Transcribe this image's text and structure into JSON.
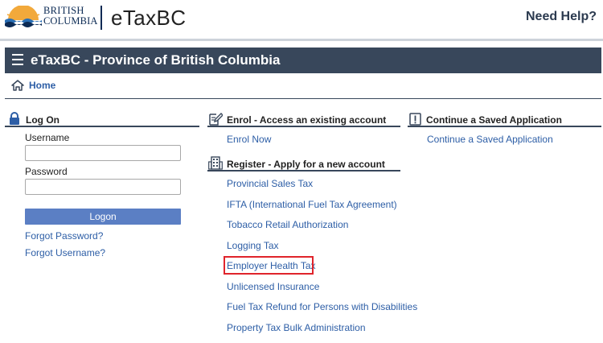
{
  "header": {
    "logo_line1": "BRITISH",
    "logo_line2": "COLUMBIA",
    "app_name": "eTaxBC",
    "help_link": "Need Help?"
  },
  "title_bar": {
    "title": "eTaxBC - Province of British Columbia",
    "menu_icon": "hamburger-menu-icon"
  },
  "breadcrumb": {
    "home_label": "Home",
    "home_icon": "home-icon"
  },
  "logon": {
    "heading": "Log On",
    "heading_icon": "lock-icon",
    "username_label": "Username",
    "username_value": "",
    "password_label": "Password",
    "password_value": "",
    "logon_button": "Logon",
    "forgot_password": "Forgot Password?",
    "forgot_username": "Forgot Username?"
  },
  "enrol": {
    "heading": "Enrol - Access an existing account",
    "heading_icon": "edit-document-icon",
    "links": [
      "Enrol Now"
    ]
  },
  "register": {
    "heading": "Register - Apply for a new account",
    "heading_icon": "building-icon",
    "links": [
      "Provincial Sales Tax",
      "IFTA (International Fuel Tax Agreement)",
      "Tobacco Retail Authorization",
      "Logging Tax",
      "Employer Health Tax",
      "Unlicensed Insurance",
      "Fuel Tax Refund for Persons with Disabilities",
      "Property Tax Bulk Administration"
    ],
    "highlighted": "Employer Health Tax"
  },
  "continue": {
    "heading": "Continue a Saved Application",
    "heading_icon": "exclamation-box-icon",
    "links": [
      "Continue a Saved Application"
    ]
  },
  "colors": {
    "title_bar_bg": "#38475b",
    "link": "#2d5ea6",
    "button": "#5b7fc4",
    "highlight": "#e0242b",
    "logo_navy": "#0b2a54",
    "logo_gold": "#f2a93b"
  }
}
